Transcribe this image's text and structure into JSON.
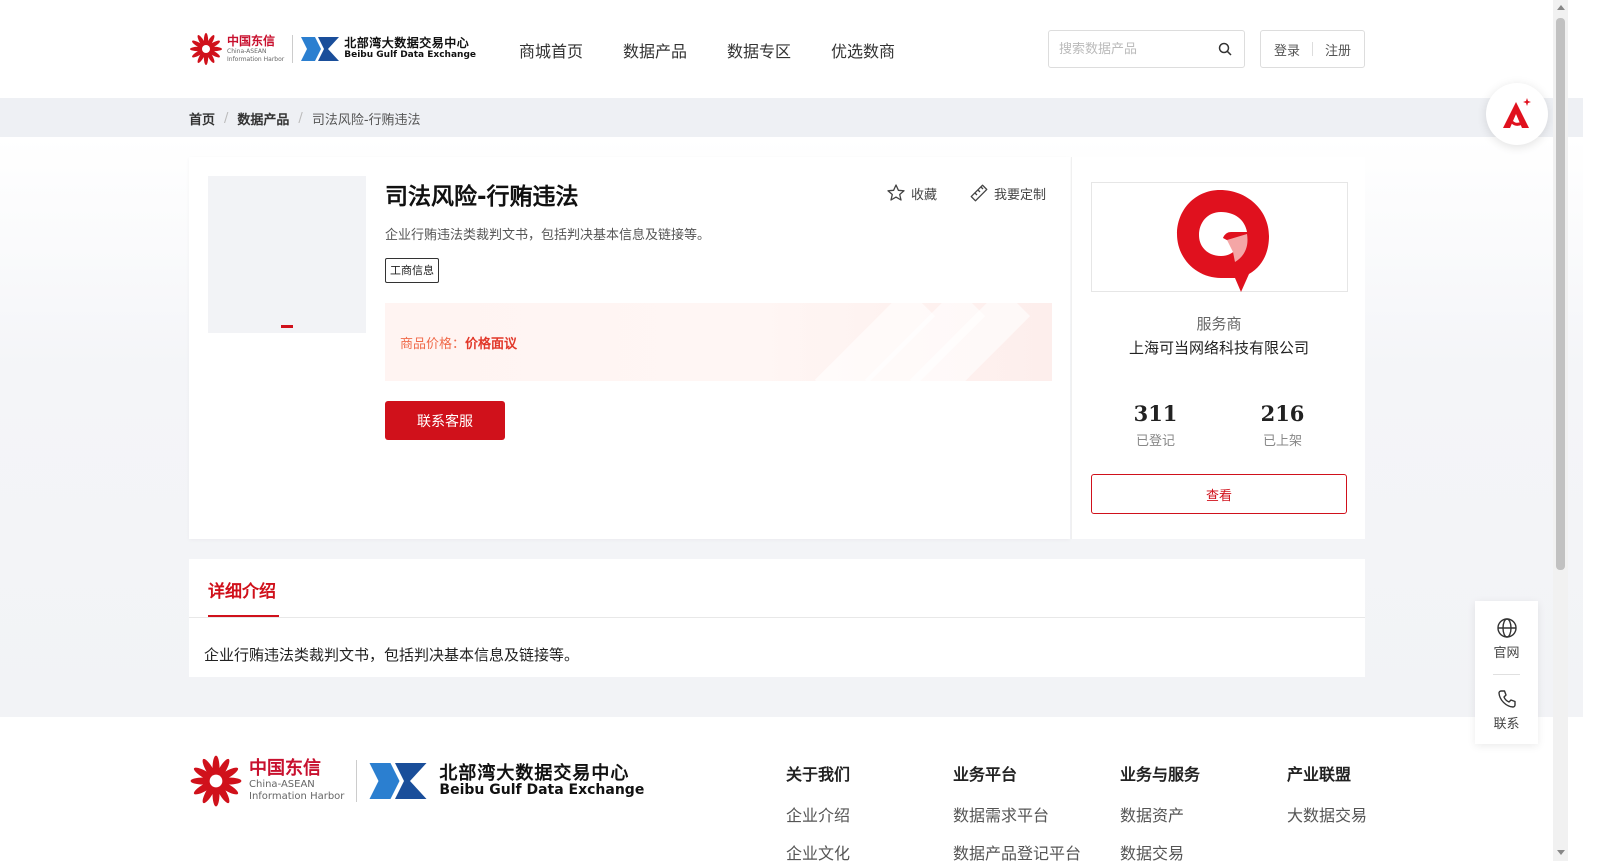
{
  "header": {
    "logo_china": {
      "cn": "中国东信",
      "en_line1": "China-ASEAN",
      "en_line2": "Information Harbor"
    },
    "logo_bbw": {
      "cn": "北部湾大数据交易中心",
      "en": "Beibu Gulf Data Exchange"
    },
    "nav": [
      "商城首页",
      "数据产品",
      "数据专区",
      "优选数商"
    ],
    "search_placeholder": "搜索数据产品",
    "login": "登录",
    "register": "注册"
  },
  "breadcrumb": {
    "home": "首页",
    "category": "数据产品",
    "current": "司法风险-行贿违法"
  },
  "product": {
    "title": "司法风险-行贿违法",
    "favorite": "收藏",
    "customize": "我要定制",
    "description": "企业行贿违法类裁判文书，包括判决基本信息及链接等。",
    "tag": "工商信息",
    "price_label": "商品价格：",
    "price_value": "价格面议",
    "contact_button": "联系客服"
  },
  "provider": {
    "label": "服务商",
    "name": "上海可当网络科技有限公司",
    "stats": [
      {
        "value": "311",
        "label": "已登记"
      },
      {
        "value": "216",
        "label": "已上架"
      }
    ],
    "view_button": "查看"
  },
  "detail": {
    "tab": "详细介绍",
    "text": "企业行贿违法类裁判文书，包括判决基本信息及链接等。"
  },
  "footer": {
    "columns": [
      {
        "head": "关于我们",
        "items": [
          "企业介绍",
          "企业文化"
        ]
      },
      {
        "head": "业务平台",
        "items": [
          "数据需求平台",
          "数据产品登记平台"
        ]
      },
      {
        "head": "业务与服务",
        "items": [
          "数据资产",
          "数据交易"
        ]
      },
      {
        "head": "产业联盟",
        "items": [
          "大数据交易"
        ]
      }
    ]
  },
  "float_panel": {
    "official": "官网",
    "contact": "联系"
  },
  "colors": {
    "accent": "#d0111b",
    "price": "#f06a4a",
    "breadcrumb_bg": "#eef0f4"
  }
}
